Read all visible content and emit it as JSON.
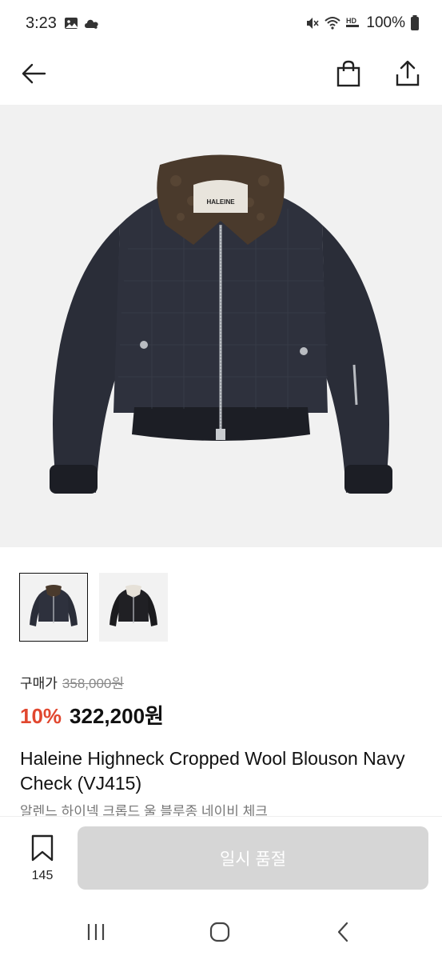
{
  "status_bar": {
    "time": "3:23",
    "battery": "100%",
    "icons": [
      "gallery-icon",
      "cloud-icon",
      "mute-icon",
      "wifi-icon",
      "hd-voice-icon",
      "battery-icon"
    ]
  },
  "header": {
    "icons": [
      "back-arrow-icon",
      "shopping-bag-icon",
      "share-icon"
    ]
  },
  "product": {
    "image_brand_label": "HALEINE",
    "thumbnails": [
      "navy-check-jacket",
      "black-jacket-white-collar"
    ],
    "price_label": "구매가",
    "original_price": "358,000원",
    "discount": "10%",
    "sale_price": "322,200원",
    "title_en": "Haleine Highneck Cropped Wool Blouson Navy Check (VJ415)",
    "title_ko": "알렌느 하이넥 크롭드 울 블루종 네이비 체크"
  },
  "bottom_bar": {
    "wish_count": "145",
    "soldout_label": "일시 품절"
  },
  "colors": {
    "discount": "#e1472f",
    "soldout_bg": "#d6d6d6",
    "hero_bg": "#f1f1f1",
    "jacket_body": "#2a2d38",
    "collar": "#4a3a2c"
  }
}
